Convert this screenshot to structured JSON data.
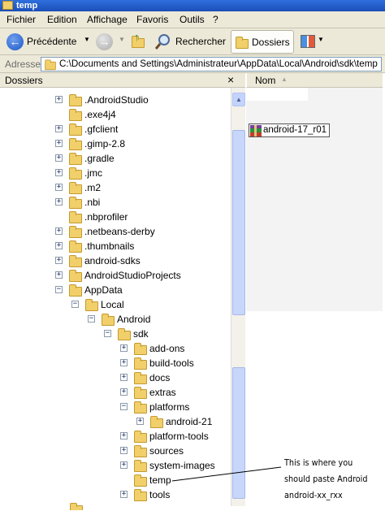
{
  "window": {
    "title": "temp"
  },
  "menu": [
    "Fichier",
    "Edition",
    "Affichage",
    "Favoris",
    "Outils",
    "?"
  ],
  "toolbar": {
    "back_label": "Précédente",
    "search_label": "Rechercher",
    "folders_label": "Dossiers"
  },
  "address": {
    "label": "Adresse",
    "path": "C:\\Documents and Settings\\Administrateur\\AppData\\Local\\Android\\sdk\\temp"
  },
  "tree_panel": {
    "title": "Dossiers",
    "close": "×"
  },
  "file_list": {
    "column_name": "Nom",
    "sort_indicator": "▲",
    "items": [
      "android-17_r01"
    ]
  },
  "tree": [
    {
      "label": ".AndroidStudio",
      "expander": "+"
    },
    {
      "label": ".exe4j4",
      "expander": ""
    },
    {
      "label": ".gfclient",
      "expander": "+"
    },
    {
      "label": ".gimp-2.8",
      "expander": "+"
    },
    {
      "label": ".gradle",
      "expander": "+"
    },
    {
      "label": ".jmc",
      "expander": "+"
    },
    {
      "label": ".m2",
      "expander": "+"
    },
    {
      "label": ".nbi",
      "expander": "+"
    },
    {
      "label": ".nbprofiler",
      "expander": ""
    },
    {
      "label": ".netbeans-derby",
      "expander": "+"
    },
    {
      "label": ".thumbnails",
      "expander": "+"
    },
    {
      "label": "android-sdks",
      "expander": "+"
    },
    {
      "label": "AndroidStudioProjects",
      "expander": "+"
    },
    {
      "label": "AppData",
      "expander": "−"
    },
    {
      "label": "Local",
      "expander": "−"
    },
    {
      "label": "Android",
      "expander": "−"
    },
    {
      "label": "sdk",
      "expander": "−"
    },
    {
      "label": "add-ons",
      "expander": "+"
    },
    {
      "label": "build-tools",
      "expander": "+"
    },
    {
      "label": "docs",
      "expander": "+"
    },
    {
      "label": "extras",
      "expander": "+"
    },
    {
      "label": "platforms",
      "expander": "−"
    },
    {
      "label": "android-21",
      "expander": "+"
    },
    {
      "label": "platform-tools",
      "expander": "+"
    },
    {
      "label": "sources",
      "expander": "+"
    },
    {
      "label": "system-images",
      "expander": "+"
    },
    {
      "label": "temp",
      "expander": ""
    },
    {
      "label": "tools",
      "expander": "+"
    }
  ],
  "annotation": {
    "lines": [
      "This is where you",
      "should paste Android",
      "android-xx_rxx"
    ]
  }
}
